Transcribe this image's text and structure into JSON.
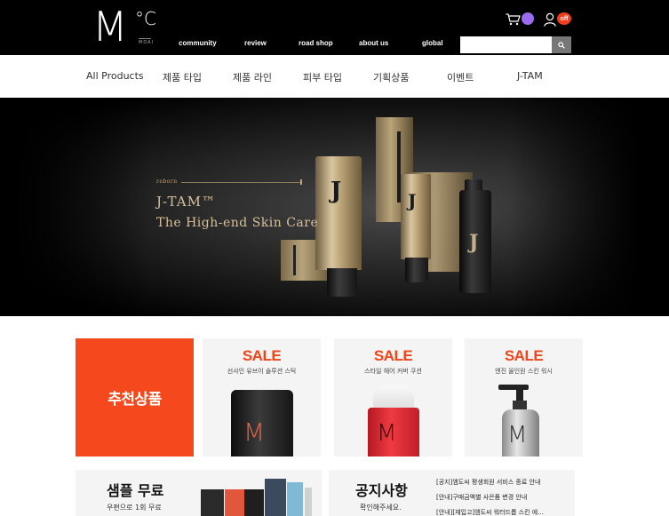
{
  "brand": {
    "logo_letter": "M",
    "logo_degree": "°C",
    "logo_small": "MOAI"
  },
  "top_nav": [
    {
      "label": "community"
    },
    {
      "label": "review"
    },
    {
      "label": "road shop"
    },
    {
      "label": "about us"
    },
    {
      "label": "global"
    }
  ],
  "search": {
    "placeholder": ""
  },
  "badges": {
    "off_label": "off"
  },
  "category_nav": [
    {
      "label": "All Products"
    },
    {
      "label": "제품 타입"
    },
    {
      "label": "제품 라인"
    },
    {
      "label": "피부 타입"
    },
    {
      "label": "기획상품"
    },
    {
      "label": "이벤트"
    },
    {
      "label": "J-TAM"
    }
  ],
  "hero": {
    "kicker": "reborn",
    "title": "J-TAM™",
    "subtitle": "The High-end Skin Care",
    "product_mark": "J"
  },
  "recommend": {
    "label": "추천상품"
  },
  "products": [
    {
      "sale": "SALE",
      "name": "선샤인 유브이 솔루션 스틱",
      "logo": "M"
    },
    {
      "sale": "SALE",
      "name": "스타일 헤어 커버 쿠션",
      "logo": "M"
    },
    {
      "sale": "SALE",
      "name": "엔진 올인원 스킨 워시",
      "logo": "M"
    }
  ],
  "sample": {
    "title": "샘플 무료",
    "sub": "우편으로 1회 무료"
  },
  "notice": {
    "title": "공지사항",
    "sub": "확인해주세요.",
    "items": [
      "[공지]엠도씨 평생회원 서비스 종료 안내",
      "[안내]구매금액별 사은품 변경 안내",
      "[안내][재입고]엠도씨 워터드롭 스킨 에..."
    ]
  },
  "colors": {
    "accent_orange": "#f5481c",
    "sale_red": "#f24419",
    "cart_badge": "#9b6cf0",
    "off_badge": "#f03e1c"
  }
}
